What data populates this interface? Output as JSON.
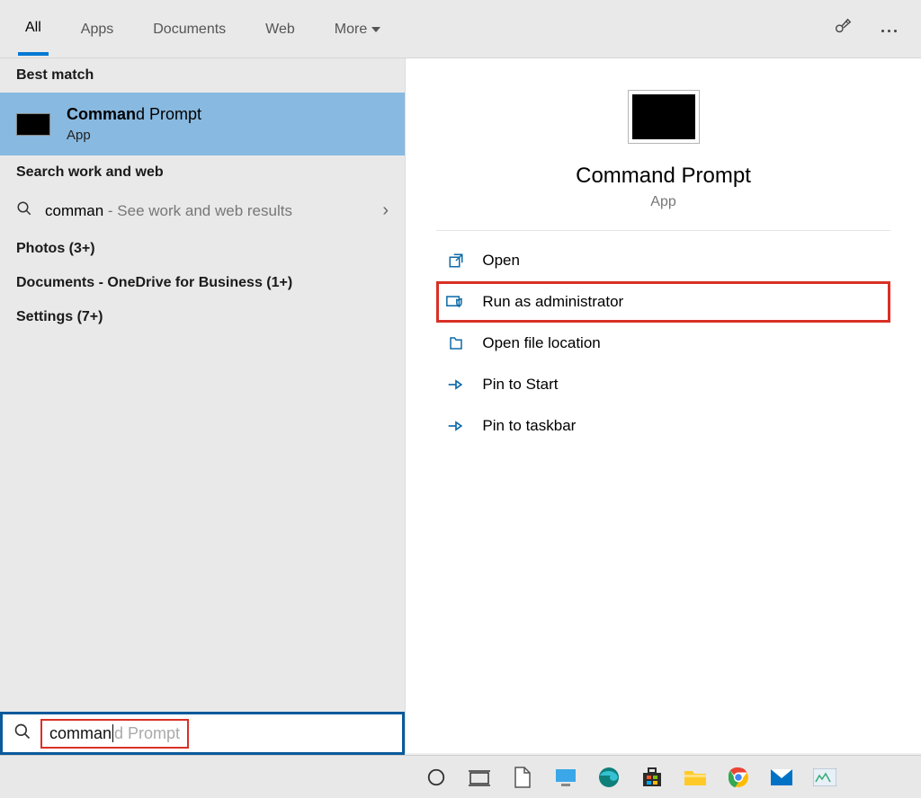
{
  "tabs": {
    "all": "All",
    "apps": "Apps",
    "documents": "Documents",
    "web": "Web",
    "more": "More"
  },
  "left": {
    "best_match_header": "Best match",
    "best_match": {
      "title_bold": "Comman",
      "title_rest": "d Prompt",
      "subtitle": "App"
    },
    "work_web_header": "Search work and web",
    "work_web": {
      "query": "comman",
      "hint": " - See work and web results"
    },
    "category_photos": "Photos (3+)",
    "category_docs": "Documents - OneDrive for Business (1+)",
    "category_settings": "Settings (7+)"
  },
  "preview": {
    "title": "Command Prompt",
    "subtitle": "App",
    "actions": {
      "open": "Open",
      "run_admin": "Run as administrator",
      "open_loc": "Open file location",
      "pin_start": "Pin to Start",
      "pin_taskbar": "Pin to taskbar"
    }
  },
  "search": {
    "typed": "comman",
    "ghost": "d Prompt"
  }
}
